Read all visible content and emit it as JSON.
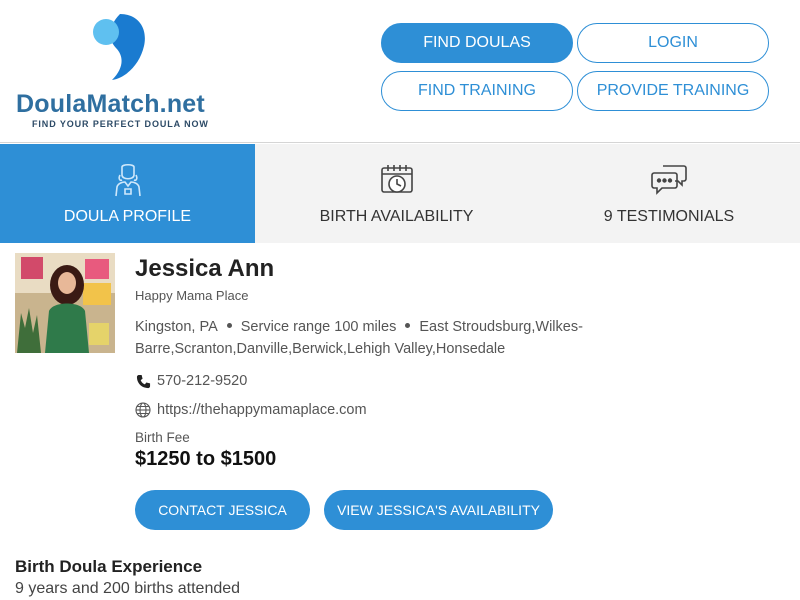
{
  "brand": {
    "name_part1": "Doula",
    "name_part2": "Match.net",
    "tagline": "FIND YOUR PERFECT DOULA NOW",
    "colors": {
      "primary": "#2e8fd6",
      "logo_light": "#5fc0f0",
      "logo_dark": "#1a7bd0"
    }
  },
  "nav": {
    "find_doulas": "FIND DOULAS",
    "login": "LOGIN",
    "find_training": "FIND TRAINING",
    "provide_training": "PROVIDE TRAINING"
  },
  "tabs": [
    {
      "label": "DOULA PROFILE",
      "icon": "doula-person-icon",
      "active": true
    },
    {
      "label": "BIRTH AVAILABILITY",
      "icon": "calendar-clock-icon",
      "active": false
    },
    {
      "label": "9 TESTIMONIALS",
      "icon": "chat-bubbles-icon",
      "active": false
    }
  ],
  "profile": {
    "name": "Jessica Ann",
    "business": "Happy Mama Place",
    "city": "Kingston, PA",
    "service_range": "Service range 100 miles",
    "areas": "East Stroudsburg,Wilkes-Barre,Scranton,Danville,Berwick,Lehigh Valley,Honsedale",
    "phone": "570-212-9520",
    "website": "https://thehappymamaplace.com",
    "fee_label": "Birth Fee",
    "fee_value": "$1250 to $1500"
  },
  "actions": {
    "contact": "CONTACT JESSICA",
    "availability": "VIEW JESSICA'S AVAILABILITY"
  },
  "experience": {
    "title": "Birth Doula Experience",
    "value": "9 years and 200 births attended"
  }
}
